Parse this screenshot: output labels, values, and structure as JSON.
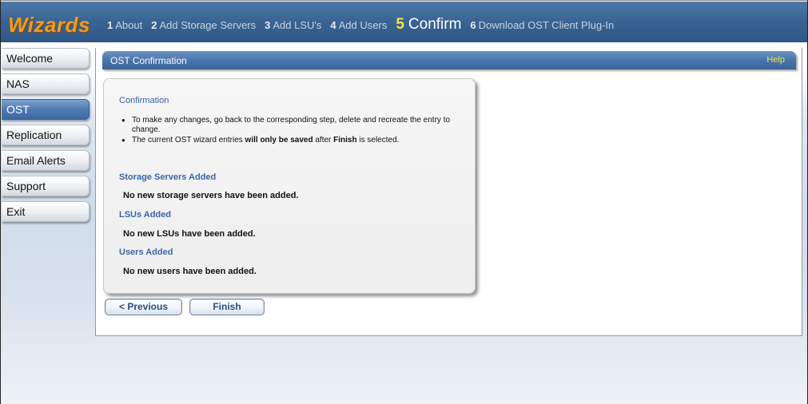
{
  "header": {
    "brand": "Wizards",
    "steps": [
      {
        "num": "1",
        "label": "About"
      },
      {
        "num": "2",
        "label": "Add Storage Servers"
      },
      {
        "num": "3",
        "label": "Add LSU's"
      },
      {
        "num": "4",
        "label": "Add Users"
      },
      {
        "num": "5",
        "label": "Confirm",
        "active": true
      },
      {
        "num": "6",
        "label": "Download OST Client Plug-In"
      }
    ]
  },
  "sidebar": {
    "items": [
      {
        "label": "Welcome"
      },
      {
        "label": "NAS"
      },
      {
        "label": "OST",
        "active": true
      },
      {
        "label": "Replication"
      },
      {
        "label": "Email Alerts"
      },
      {
        "label": "Support"
      },
      {
        "label": "Exit"
      }
    ]
  },
  "panel": {
    "title": "OST Confirmation",
    "help": "Help"
  },
  "confirmation": {
    "heading": "Confirmation",
    "bullet1": "To make any changes, go back to the corresponding step, delete and recreate the entry to change.",
    "bullet2_pre": "The current OST wizard entries ",
    "bullet2_bold1": "will only be saved",
    "bullet2_mid": " after ",
    "bullet2_bold2": "Finish",
    "bullet2_post": " is selected.",
    "storage_title": "Storage Servers Added",
    "storage_value": "No new storage servers have been added.",
    "lsu_title": "LSUs Added",
    "lsu_value": "No new LSUs have been added.",
    "users_title": "Users Added",
    "users_value": "No new users have been added."
  },
  "buttons": {
    "previous": "< Previous",
    "finish": "Finish"
  },
  "colors": {
    "header": "#3b6595",
    "brand": "#f39a1e",
    "active_step": "#f6e34a",
    "section_title": "#3a64a8",
    "help": "#f1e64a"
  }
}
